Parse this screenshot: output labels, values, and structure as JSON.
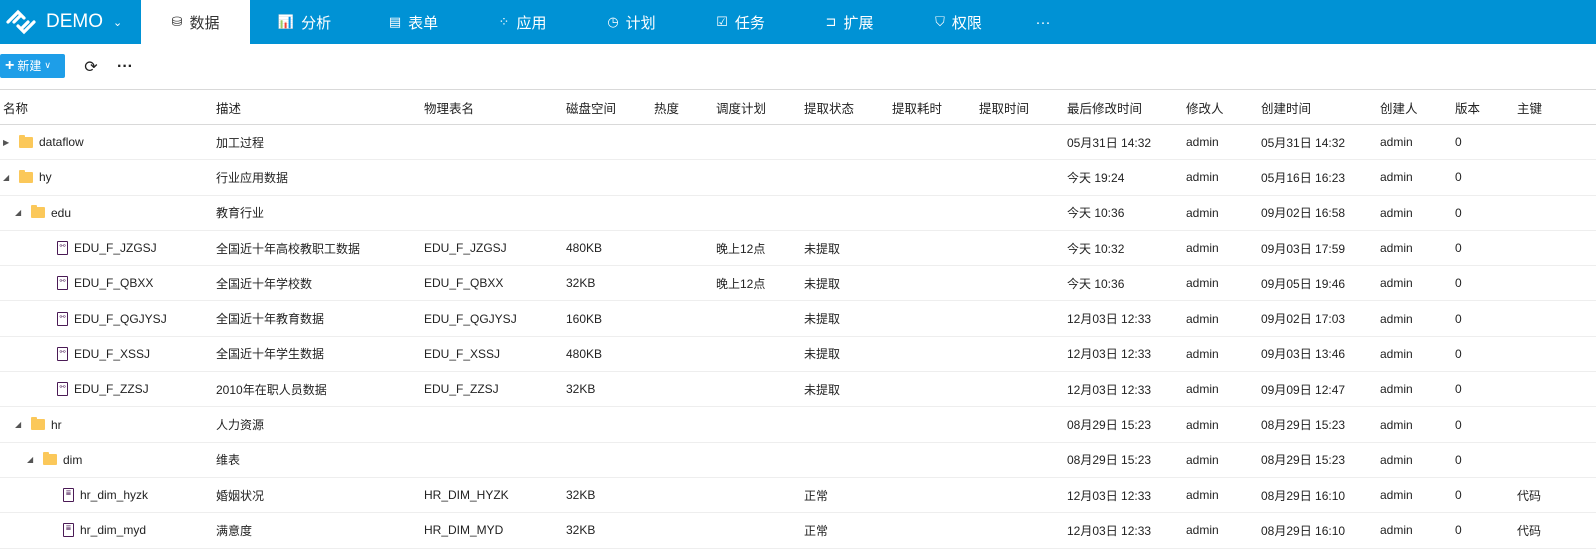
{
  "app": {
    "title": "DEMO"
  },
  "nav": [
    {
      "label": "数据",
      "icon": "database-icon",
      "glyph": "⛁"
    },
    {
      "label": "分析",
      "icon": "bar-chart-icon",
      "glyph": "📊"
    },
    {
      "label": "表单",
      "icon": "form-icon",
      "glyph": "▤"
    },
    {
      "label": "应用",
      "icon": "apps-icon",
      "glyph": "⁘"
    },
    {
      "label": "计划",
      "icon": "clock-icon",
      "glyph": "◷"
    },
    {
      "label": "任务",
      "icon": "task-icon",
      "glyph": "☑"
    },
    {
      "label": "扩展",
      "icon": "extension-icon",
      "glyph": "⊐"
    },
    {
      "label": "权限",
      "icon": "shield-icon",
      "glyph": "⛉"
    },
    {
      "label": "···",
      "icon": "more-icon",
      "glyph": ""
    }
  ],
  "toolbar": {
    "new_label": "新建"
  },
  "columns": [
    "名称",
    "描述",
    "物理表名",
    "磁盘空间",
    "热度",
    "调度计划",
    "提取状态",
    "提取耗时",
    "提取时间",
    "最后修改时间",
    "修改人",
    "创建时间",
    "创建人",
    "版本",
    "主键"
  ],
  "rows": [
    {
      "type": "folder",
      "level": 0,
      "expanded": false,
      "cells": [
        "dataflow",
        "加工过程",
        "",
        "",
        "",
        "",
        "",
        "",
        "",
        "05月31日 14:32",
        "admin",
        "05月31日 14:32",
        "admin",
        "0",
        ""
      ]
    },
    {
      "type": "folder",
      "level": 0,
      "expanded": true,
      "cells": [
        "hy",
        "行业应用数据",
        "",
        "",
        "",
        "",
        "",
        "",
        "",
        "今天 19:24",
        "admin",
        "05月16日 16:23",
        "admin",
        "0",
        ""
      ]
    },
    {
      "type": "folder",
      "level": 1,
      "expanded": true,
      "cells": [
        "edu",
        "教育行业",
        "",
        "",
        "",
        "",
        "",
        "",
        "",
        "今天 10:36",
        "admin",
        "09月02日 16:58",
        "admin",
        "0",
        ""
      ]
    },
    {
      "type": "flow",
      "level": 2,
      "cells": [
        "EDU_F_JZGSJ",
        "全国近十年高校教职工数据",
        "EDU_F_JZGSJ",
        "480KB",
        "",
        "晚上12点",
        "未提取",
        "",
        "",
        "今天 10:32",
        "admin",
        "09月03日 17:59",
        "admin",
        "0",
        ""
      ]
    },
    {
      "type": "flow",
      "level": 2,
      "cells": [
        "EDU_F_QBXX",
        "全国近十年学校数",
        "EDU_F_QBXX",
        "32KB",
        "",
        "晚上12点",
        "未提取",
        "",
        "",
        "今天 10:36",
        "admin",
        "09月05日 19:46",
        "admin",
        "0",
        ""
      ]
    },
    {
      "type": "flow",
      "level": 2,
      "cells": [
        "EDU_F_QGJYSJ",
        "全国近十年教育数据",
        "EDU_F_QGJYSJ",
        "160KB",
        "",
        "",
        "未提取",
        "",
        "",
        "12月03日 12:33",
        "admin",
        "09月02日 17:03",
        "admin",
        "0",
        ""
      ]
    },
    {
      "type": "flow",
      "level": 2,
      "cells": [
        "EDU_F_XSSJ",
        "全国近十年学生数据",
        "EDU_F_XSSJ",
        "480KB",
        "",
        "",
        "未提取",
        "",
        "",
        "12月03日 12:33",
        "admin",
        "09月03日 13:46",
        "admin",
        "0",
        ""
      ]
    },
    {
      "type": "flow",
      "level": 2,
      "cells": [
        "EDU_F_ZZSJ",
        "2010年在职人员数据",
        "EDU_F_ZZSJ",
        "32KB",
        "",
        "",
        "未提取",
        "",
        "",
        "12月03日 12:33",
        "admin",
        "09月09日 12:47",
        "admin",
        "0",
        ""
      ]
    },
    {
      "type": "folder",
      "level": 1,
      "expanded": true,
      "cells": [
        "hr",
        "人力资源",
        "",
        "",
        "",
        "",
        "",
        "",
        "",
        "08月29日 15:23",
        "admin",
        "08月29日 15:23",
        "admin",
        "0",
        ""
      ]
    },
    {
      "type": "folder",
      "level": 2,
      "expanded": true,
      "cells": [
        "dim",
        "维表",
        "",
        "",
        "",
        "",
        "",
        "",
        "",
        "08月29日 15:23",
        "admin",
        "08月29日 15:23",
        "admin",
        "0",
        ""
      ]
    },
    {
      "type": "table",
      "level": 3,
      "cells": [
        "hr_dim_hyzk",
        "婚姻状况",
        "HR_DIM_HYZK",
        "32KB",
        "",
        "",
        "正常",
        "",
        "",
        "12月03日 12:33",
        "admin",
        "08月29日 16:10",
        "admin",
        "0",
        "代码"
      ]
    },
    {
      "type": "table",
      "level": 3,
      "cells": [
        "hr_dim_myd",
        "满意度",
        "HR_DIM_MYD",
        "32KB",
        "",
        "",
        "正常",
        "",
        "",
        "12月03日 12:33",
        "admin",
        "08月29日 16:10",
        "admin",
        "0",
        "代码"
      ]
    }
  ]
}
